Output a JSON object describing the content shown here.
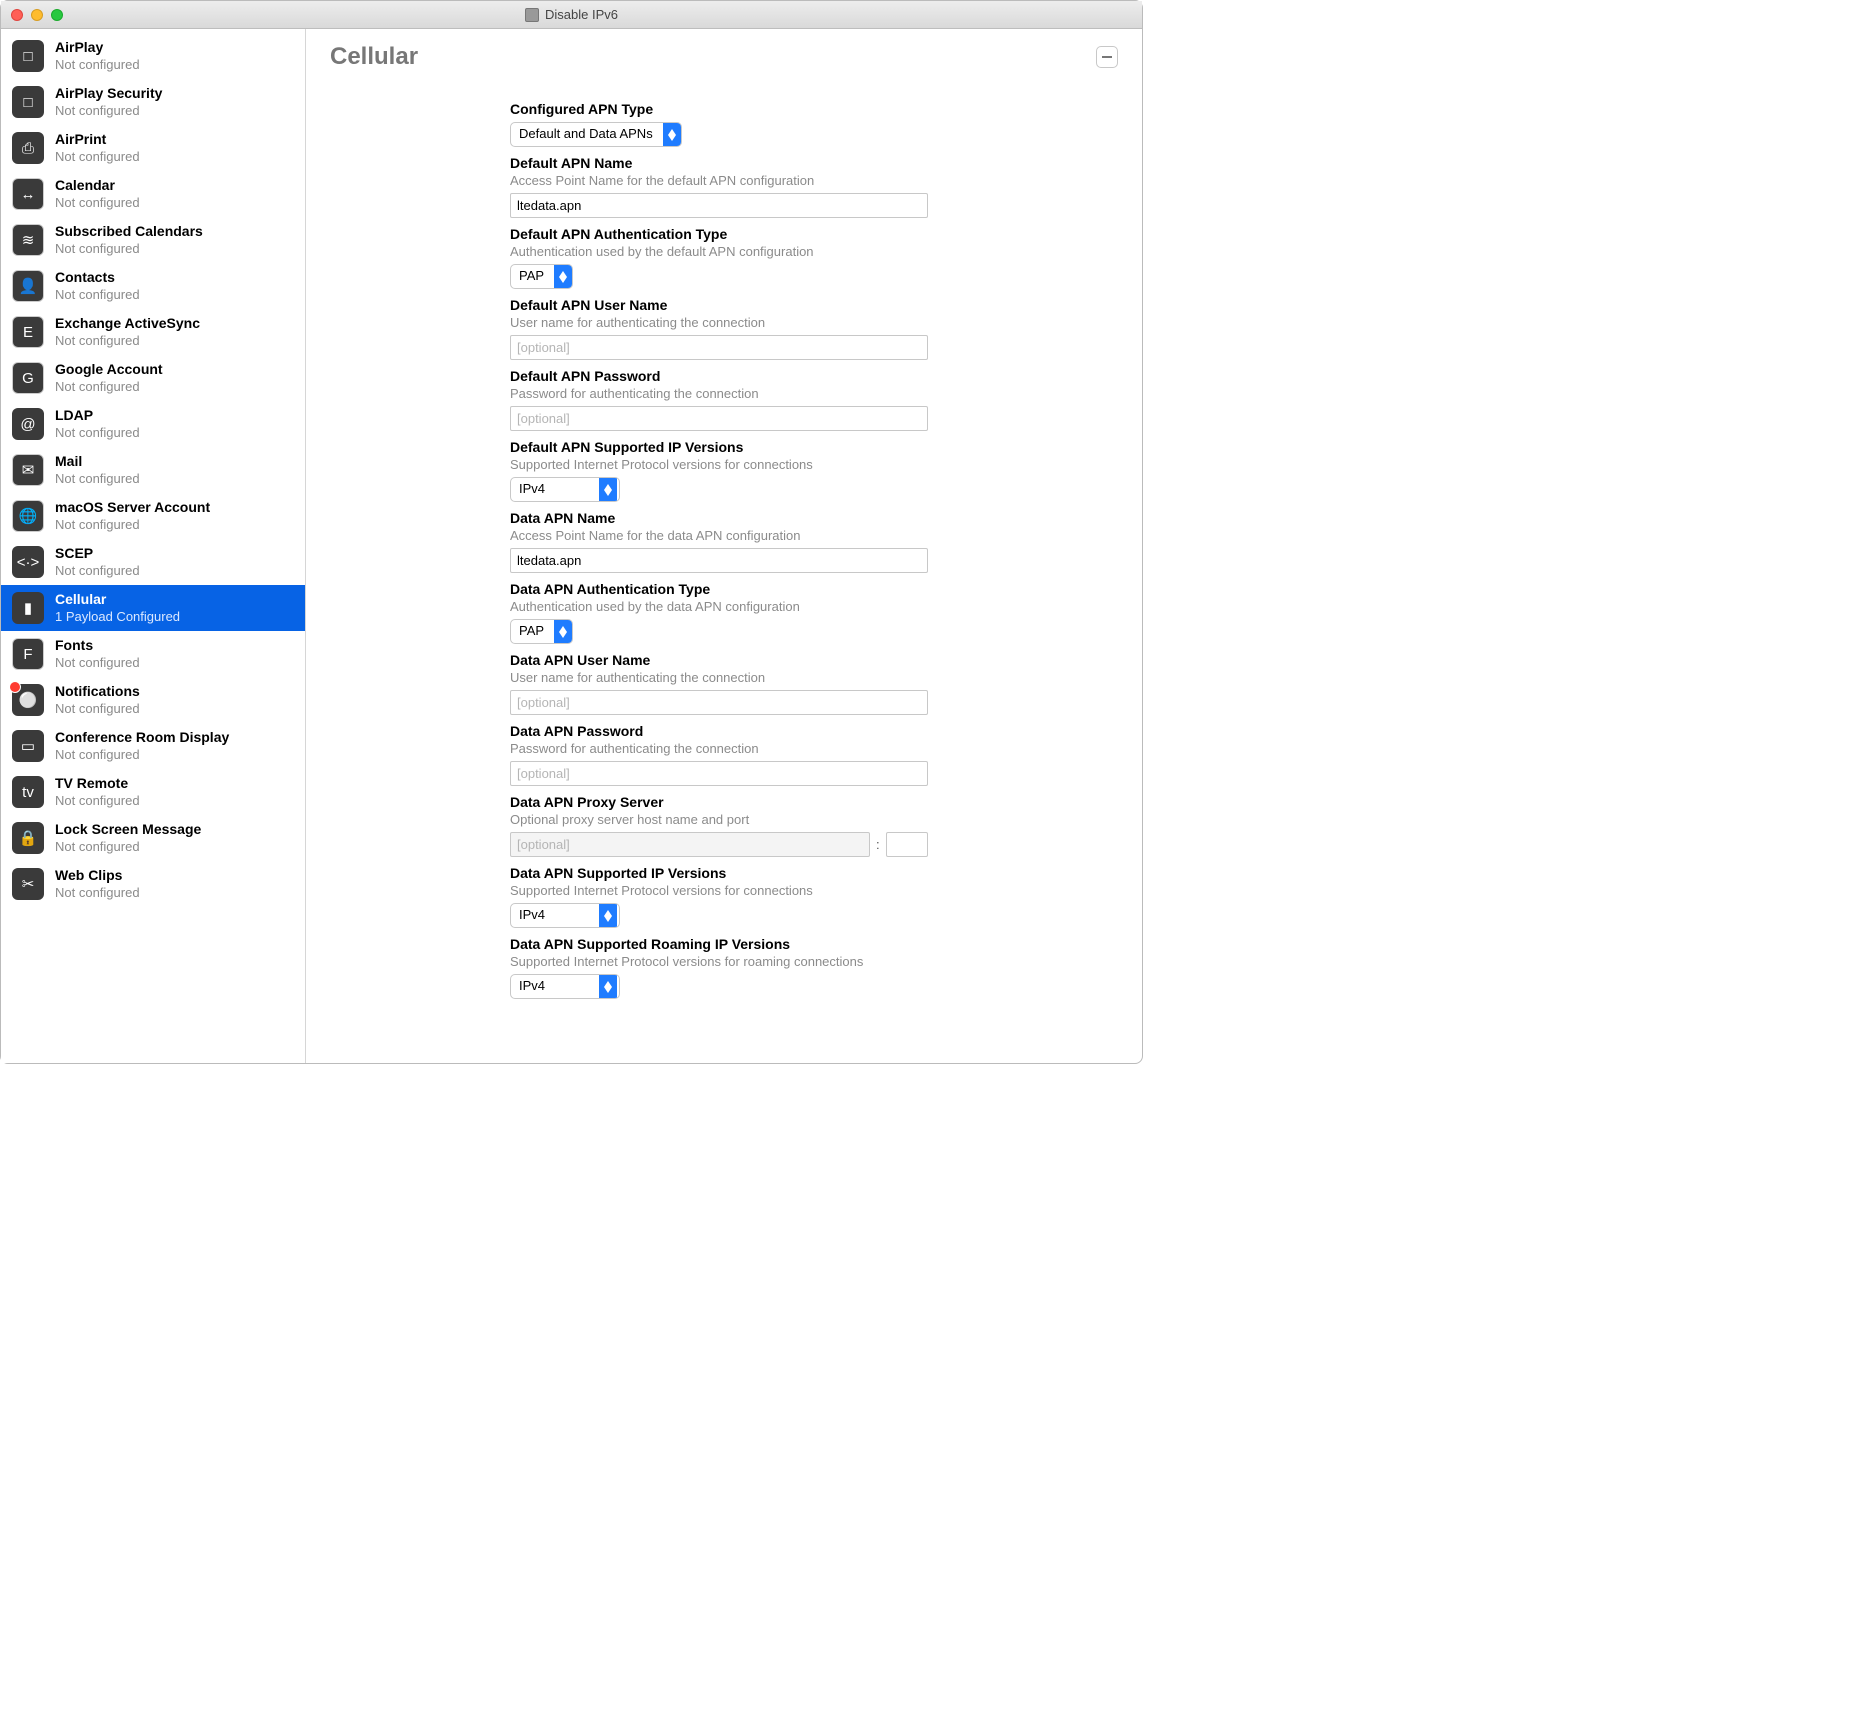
{
  "window": {
    "title": "Disable IPv6"
  },
  "sidebar": {
    "not_configured": "Not configured",
    "items": [
      {
        "key": "airplay",
        "title": "AirPlay",
        "sub": "Not configured",
        "selected": false
      },
      {
        "key": "airplay-security",
        "title": "AirPlay Security",
        "sub": "Not configured",
        "selected": false
      },
      {
        "key": "airprint",
        "title": "AirPrint",
        "sub": "Not configured",
        "selected": false
      },
      {
        "key": "calendar",
        "title": "Calendar",
        "sub": "Not configured",
        "selected": false
      },
      {
        "key": "subscribed-calendars",
        "title": "Subscribed Calendars",
        "sub": "Not configured",
        "selected": false
      },
      {
        "key": "contacts",
        "title": "Contacts",
        "sub": "Not configured",
        "selected": false
      },
      {
        "key": "exchange",
        "title": "Exchange ActiveSync",
        "sub": "Not configured",
        "selected": false
      },
      {
        "key": "google",
        "title": "Google Account",
        "sub": "Not configured",
        "selected": false
      },
      {
        "key": "ldap",
        "title": "LDAP",
        "sub": "Not configured",
        "selected": false
      },
      {
        "key": "mail",
        "title": "Mail",
        "sub": "Not configured",
        "selected": false
      },
      {
        "key": "macos-server",
        "title": "macOS Server Account",
        "sub": "Not configured",
        "selected": false
      },
      {
        "key": "scep",
        "title": "SCEP",
        "sub": "Not configured",
        "selected": false
      },
      {
        "key": "cellular",
        "title": "Cellular",
        "sub": "1 Payload Configured",
        "selected": true
      },
      {
        "key": "fonts",
        "title": "Fonts",
        "sub": "Not configured",
        "selected": false
      },
      {
        "key": "notifications",
        "title": "Notifications",
        "sub": "Not configured",
        "selected": false,
        "badge": true
      },
      {
        "key": "conf-room",
        "title": "Conference Room Display",
        "sub": "Not configured",
        "selected": false
      },
      {
        "key": "tv-remote",
        "title": "TV Remote",
        "sub": "Not configured",
        "selected": false
      },
      {
        "key": "lock-screen",
        "title": "Lock Screen Message",
        "sub": "Not configured",
        "selected": false
      },
      {
        "key": "web-clips",
        "title": "Web Clips",
        "sub": "Not configured",
        "selected": false
      }
    ]
  },
  "detail": {
    "title": "Cellular",
    "remove_tooltip": "Remove payload",
    "fields": {
      "apn_type": {
        "label": "Configured APN Type",
        "value": "Default and Data APNs"
      },
      "default_name": {
        "label": "Default APN Name",
        "desc": "Access Point Name for the default APN configuration",
        "value": "ltedata.apn"
      },
      "default_auth": {
        "label": "Default APN Authentication Type",
        "desc": "Authentication used by the default APN configuration",
        "value": "PAP"
      },
      "default_user": {
        "label": "Default APN User Name",
        "desc": "User name for authenticating the connection",
        "placeholder": "[optional]",
        "value": ""
      },
      "default_pass": {
        "label": "Default APN Password",
        "desc": "Password for authenticating the connection",
        "placeholder": "[optional]",
        "value": ""
      },
      "default_ipver": {
        "label": "Default APN Supported IP Versions",
        "desc": "Supported Internet Protocol versions for connections",
        "value": "IPv4"
      },
      "data_name": {
        "label": "Data APN Name",
        "desc": "Access Point Name for the data APN configuration",
        "value": "ltedata.apn"
      },
      "data_auth": {
        "label": "Data APN Authentication Type",
        "desc": "Authentication used by the data APN configuration",
        "value": "PAP"
      },
      "data_user": {
        "label": "Data APN User Name",
        "desc": "User name for authenticating the connection",
        "placeholder": "[optional]",
        "value": ""
      },
      "data_pass": {
        "label": "Data APN Password",
        "desc": "Password for authenticating the connection",
        "placeholder": "[optional]",
        "value": ""
      },
      "data_proxy": {
        "label": "Data APN Proxy Server",
        "desc": "Optional proxy server host name and port",
        "placeholder": "[optional]",
        "value": "",
        "port": ""
      },
      "data_ipver": {
        "label": "Data APN Supported IP Versions",
        "desc": "Supported Internet Protocol versions for connections",
        "value": "IPv4"
      },
      "data_roam_ipver": {
        "label": "Data APN Supported Roaming IP Versions",
        "desc": "Supported Internet Protocol versions for roaming connections",
        "value": "IPv4"
      }
    },
    "colon": ":"
  },
  "icons": {
    "airplay": "□",
    "airplay-security": "□",
    "airprint": "⎙",
    "calendar": "↔",
    "subscribed-calendars": "≋",
    "contacts": "👤",
    "exchange": "E",
    "google": "G",
    "ldap": "@",
    "mail": "✉︎",
    "macos-server": "🌐",
    "scep": "<·>",
    "cellular": "▮",
    "fonts": "F",
    "notifications": "⚪",
    "conf-room": "▭",
    "tv-remote": "tv",
    "lock-screen": "🔒",
    "web-clips": "✂"
  },
  "icon_bg": {
    "airplay": "bg-dark",
    "airplay-security": "bg-dark",
    "airprint": "bg-dark",
    "calendar": "bg-white",
    "subscribed-calendars": "bg-white",
    "contacts": "bg-white",
    "exchange": "bg-white",
    "google": "bg-white",
    "ldap": "bg-blue",
    "mail": "bg-white",
    "macos-server": "bg-white",
    "scep": "bg-grey",
    "cellular": "bg-dark",
    "fonts": "bg-white",
    "notifications": "bg-grey",
    "conf-room": "bg-dark",
    "tv-remote": "bg-dark",
    "lock-screen": "bg-dark",
    "web-clips": "bg-dark"
  }
}
